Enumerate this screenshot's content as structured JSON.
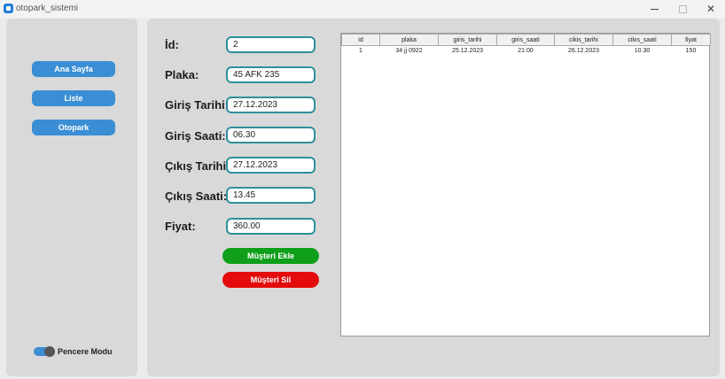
{
  "window": {
    "title": "otopark_sistemi",
    "close_glyph": "✕"
  },
  "sidebar": {
    "items": [
      {
        "label": "Ana Sayfa"
      },
      {
        "label": "Liste"
      },
      {
        "label": "Otopark"
      }
    ],
    "window_mode_label": "Pencere Modu"
  },
  "form": {
    "fields": [
      {
        "label": "İd:",
        "value": "2"
      },
      {
        "label": "Plaka:",
        "value": "45 AFK 235"
      },
      {
        "label": "Giriş Tarihi:",
        "value": "27.12.2023"
      },
      {
        "label": "Giriş Saati:",
        "value": "06.30"
      },
      {
        "label": "Çıkış Tarihi:",
        "value": "27.12.2023"
      },
      {
        "label": "Çıkış Saati:",
        "value": "13.45"
      },
      {
        "label": "Fiyat:",
        "value": "360.00"
      }
    ],
    "add_label": "Müşteri Ekle",
    "delete_label": "Müşteri Sil"
  },
  "table": {
    "columns": [
      "id",
      "plaka",
      "giris_tarihi",
      "giris_saati",
      "cikis_tarihi",
      "cikis_saati",
      "fiyat"
    ],
    "rows": [
      [
        "1",
        "34 jj 0922",
        "25.12.2023",
        "21.00",
        "26.12.2023",
        "10.30",
        "150"
      ]
    ]
  },
  "colors": {
    "accent_blue": "#3a8ed4",
    "add_green": "#0f9f1a",
    "delete_red": "#e30b0b",
    "input_border": "#2f8f9c"
  }
}
